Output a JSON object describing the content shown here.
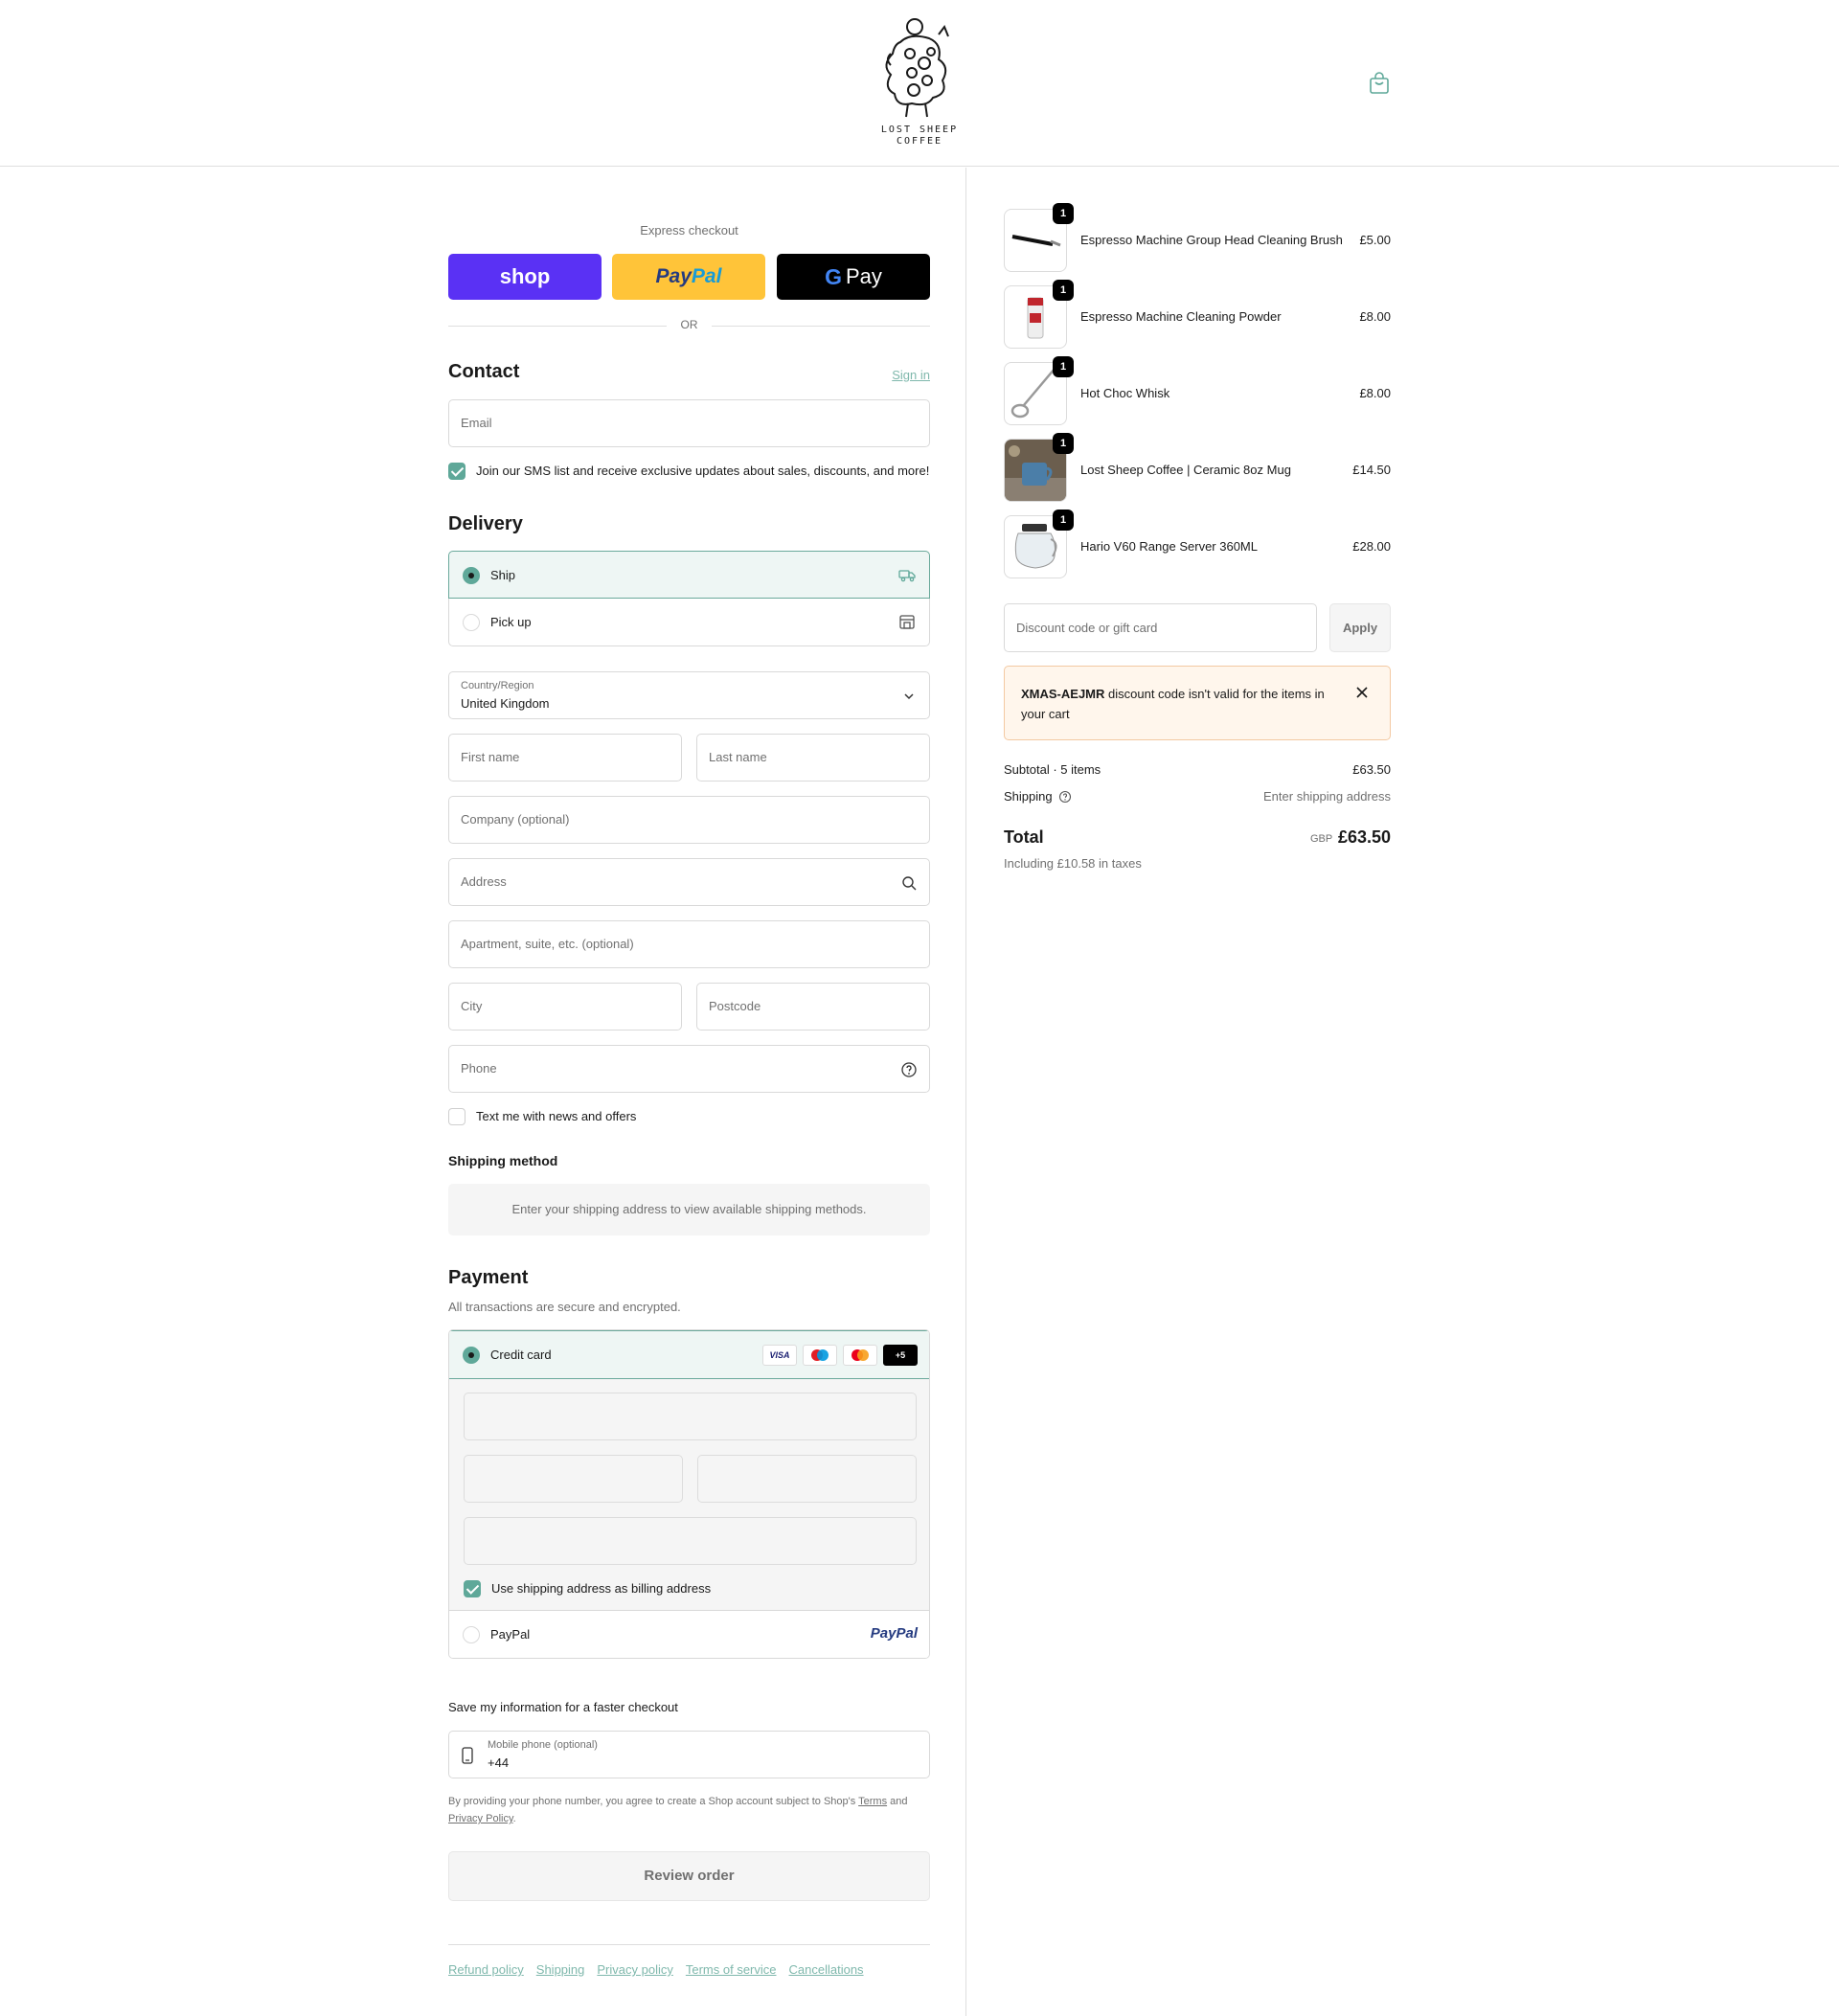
{
  "brand": {
    "line1": "LOST SHEEP",
    "line2": "COFFEE"
  },
  "express": {
    "title": "Express checkout",
    "shop": "shop",
    "paypal_a": "Pay",
    "paypal_b": "Pal",
    "gpay": "Pay",
    "or": "OR"
  },
  "contact": {
    "title": "Contact",
    "signin": "Sign in",
    "email_placeholder": "Email",
    "sms_label": "Join our SMS list and receive exclusive updates about sales, discounts, and more!"
  },
  "delivery": {
    "title": "Delivery",
    "options": [
      {
        "label": "Ship"
      },
      {
        "label": "Pick up"
      }
    ],
    "country_label": "Country/Region",
    "country_value": "United Kingdom",
    "first_name": "First name",
    "last_name": "Last name",
    "company": "Company (optional)",
    "address": "Address",
    "apartment": "Apartment, suite, etc. (optional)",
    "city": "City",
    "postcode": "Postcode",
    "phone": "Phone",
    "text_news": "Text me with news and offers"
  },
  "shipping_method": {
    "title": "Shipping method",
    "message": "Enter your shipping address to view available shipping methods."
  },
  "payment": {
    "title": "Payment",
    "subtitle": "All transactions are secure and encrypted.",
    "credit_card": "Credit card",
    "card_logos": [
      "VISA",
      "",
      "",
      "+5"
    ],
    "billing_same": "Use shipping address as billing address",
    "paypal": "PayPal",
    "paypal_logo": "PayPal"
  },
  "save_info": {
    "title": "Save my information for a faster checkout",
    "phone_label": "Mobile phone (optional)",
    "phone_value": "+44",
    "legal_1": "By providing your phone number, you agree to create a Shop account subject to Shop's",
    "terms": "Terms",
    "and": "and",
    "privacy": "Privacy Policy",
    "period": "."
  },
  "review_button": "Review order",
  "footer": [
    "Refund policy",
    "Shipping",
    "Privacy policy",
    "Terms of service",
    "Cancellations"
  ],
  "cart": {
    "items": [
      {
        "qty": "1",
        "name": "Espresso Machine Group Head Cleaning Brush",
        "price": "£5.00"
      },
      {
        "qty": "1",
        "name": "Espresso Machine Cleaning Powder",
        "price": "£8.00"
      },
      {
        "qty": "1",
        "name": "Hot Choc Whisk",
        "price": "£8.00"
      },
      {
        "qty": "1",
        "name": "Lost Sheep Coffee | Ceramic 8oz Mug",
        "price": "£14.50"
      },
      {
        "qty": "1",
        "name": "Hario V60 Range Server 360ML",
        "price": "£28.00"
      }
    ],
    "discount_placeholder": "Discount code or gift card",
    "apply": "Apply",
    "banner_code": "XMAS-AEJMR",
    "banner_text": " discount code isn't valid for the items in your cart",
    "subtotal_label": "Subtotal · 5 items",
    "subtotal_value": "£63.50",
    "shipping_label": "Shipping",
    "shipping_value": "Enter shipping address",
    "total_label": "Total",
    "total_currency": "GBP",
    "total_value": "£63.50",
    "taxes": "Including £10.58 in taxes"
  },
  "colors": {
    "accent": "#5fa899",
    "shop": "#5a31f4",
    "paypal": "#ffc439",
    "link": "#7fb8ac"
  }
}
